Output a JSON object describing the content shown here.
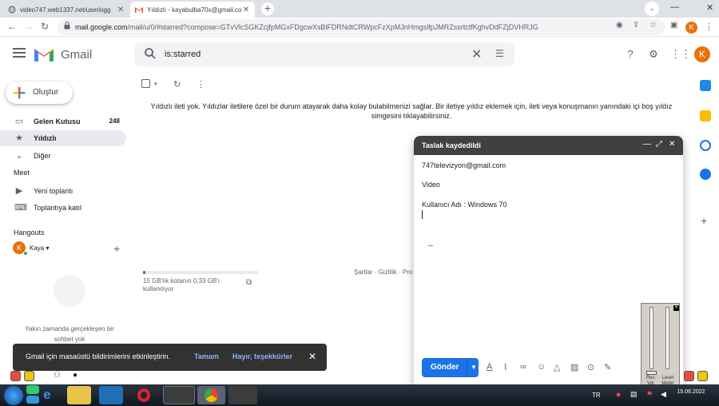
{
  "browser": {
    "tabs": [
      {
        "title": "video747.web1337.net/userlogg",
        "active": false
      },
      {
        "title": "Yıldızlı - kayabulba70x@gmail.co",
        "active": true
      }
    ],
    "url_host": "mail.google.com",
    "url_path": "/mail/u/0/#starred?compose=GTvVlcSGKZcjfpMGxFDgcwXsBlFDRNdtCRWpcFzXpMJnHmgslfpJMRZssrtctfKghvDdFZjDVHRJG",
    "profile_initial": "K"
  },
  "gmail": {
    "app_name": "Gmail",
    "search_query": "is:starred",
    "avatar_initial": "K"
  },
  "sidebar": {
    "compose_label": "Oluştur",
    "items": [
      {
        "label": "Gelen Kutusu",
        "count": "248",
        "icon": "inbox-icon"
      },
      {
        "label": "Yıldızlı",
        "count": "",
        "icon": "star-icon"
      },
      {
        "label": "Diğer",
        "count": "",
        "icon": "chevron-down-icon"
      }
    ],
    "meet_heading": "Meet",
    "meet_items": [
      {
        "label": "Yeni toplantı",
        "icon": "video-icon"
      },
      {
        "label": "Toplantıya katıl",
        "icon": "keyboard-icon"
      }
    ],
    "hangouts_heading": "Hangouts",
    "hangouts_user": "Kaya",
    "hangouts_user_initial": "K",
    "hangouts_empty": "Yakın zamanda gerçekleşen bir sohbet yok"
  },
  "main": {
    "empty_message": "Yıldızlı ileti yok. Yıldızlar iletilere özel bir durum atayarak daha kolay bulabilmenizi sağlar. Bir iletiye yıldız eklemek için, ileti veya konuşmanın yanındaki içi boş yıldız simgesini tıklayabilirsiniz.",
    "storage_text": "15 GB'lık kotanın 0,33 GB'ı kullanılıyor",
    "storage_fraction": 0.022,
    "footer_links": "Şartlar · Gizlilik · Pro"
  },
  "compose": {
    "title": "Taslak kaydedildi",
    "to": "747televizyon@gmail.com",
    "subject": "Video",
    "body": "Kullanıcı Adı : Windows 70",
    "signature": "--",
    "send_label": "Gönder"
  },
  "snackbar": {
    "message": "Gmail için masaüstü bildirimlerini etkinleştirin.",
    "ok_label": "Tamam",
    "no_label": "Hayır, teşekkürler"
  },
  "volume": {
    "left_label": "Rec. Vol.",
    "right_label": "Level Meter"
  },
  "taskbar": {
    "lang": "TR",
    "date": "15.06.2022"
  },
  "colors": {
    "accent": "#1a73e8",
    "avatar": "#e8710a",
    "compose_header": "#404040"
  }
}
